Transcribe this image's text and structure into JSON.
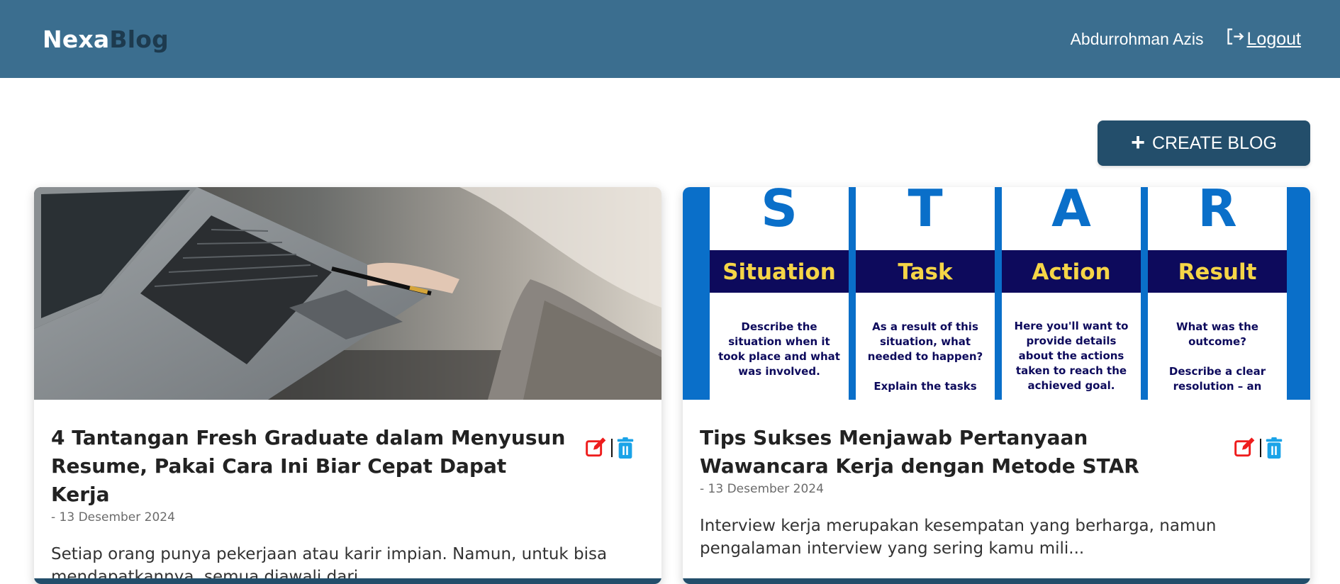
{
  "nav": {
    "brand_part1": "Nexa",
    "brand_part2": "Blog",
    "username": "Abdurrohman Azis",
    "logout_label": "Logout"
  },
  "toolbar": {
    "create_label": "CREATE BLOG"
  },
  "cards": [
    {
      "title": "4 Tantangan Fresh Graduate dalam Menyusun Resume, Pakai Cara Ini Biar Cepat Dapat Kerja",
      "date": "- 13 Desember 2024",
      "excerpt": "Setiap orang punya pekerjaan atau karir impian. Namun, untuk bisa mendapatkannya, semua diawali dari...",
      "image": "laptop-photo"
    },
    {
      "title": "Tips Sukses Menjawab Pertanyaan Wawancara Kerja dengan Metode STAR",
      "date": "- 13 Desember 2024",
      "excerpt": "Interview kerja merupakan kesempatan yang berharga, namun pengalaman interview yang sering kamu mili...",
      "image": "star-method-infographic",
      "image_text": {
        "letters": [
          "S",
          "T",
          "A",
          "R"
        ],
        "headers": [
          "Situation",
          "Task",
          "Action",
          "Result"
        ],
        "col1": [
          "Describe the",
          "situation when it",
          "took place and what",
          "was involved."
        ],
        "col2": [
          "As a result of this",
          "situation, what",
          "needed to happen?",
          "Explain the tasks"
        ],
        "col3": [
          "Here you'll want to",
          "provide details",
          "about the actions",
          "taken to reach the",
          "achieved goal."
        ],
        "col4": [
          "What was the",
          "outcome?",
          "Describe a clear",
          "resolution – an"
        ]
      }
    }
  ],
  "icons": {
    "edit": "edit-icon",
    "delete": "trash-icon",
    "logout": "logout-icon",
    "add": "plus-icon"
  },
  "colors": {
    "navbar": "#3b6e8f",
    "brand_dark": "#1d3a4e",
    "button": "#234e6b",
    "edit": "#ee1c1c",
    "delete": "#1aa3e8",
    "star_blue": "#0a6fc9",
    "star_navy": "#0d0a5c",
    "star_yellow": "#f5d547"
  }
}
